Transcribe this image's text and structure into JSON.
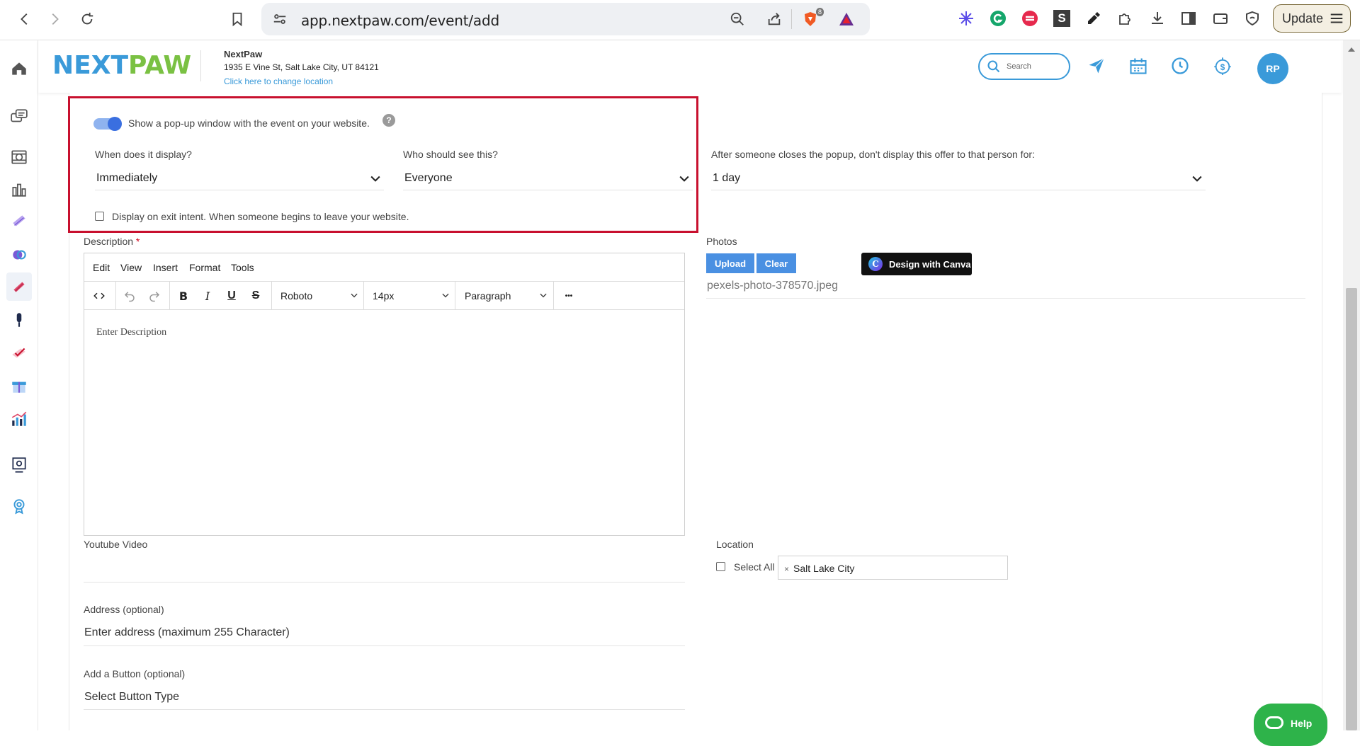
{
  "browser": {
    "url": "app.nextpaw.com/event/add",
    "update_label": "Update",
    "brave_badge": "8",
    "ext_s_label": "S"
  },
  "header": {
    "logo_next": "NEXT",
    "logo_paw": "PAW",
    "location_name": "NextPaw",
    "location_address": "1935 E Vine St, Salt Lake City, UT 84121",
    "change_location": "Click here to change location",
    "search_placeholder": "Search",
    "avatar_initials": "RP"
  },
  "popup": {
    "toggle_label": "Show a pop-up window with the event on your website.",
    "help_glyph": "?",
    "toggle_on": true,
    "when_label": "When does it display?",
    "when_value": "Immediately",
    "who_label": "Who should see this?",
    "who_value": "Everyone",
    "exit_intent_label": "Display on exit intent. When someone begins to leave your website.",
    "exit_intent_checked": false,
    "after_close_label": "After someone closes the popup, don't display this offer to that person for:",
    "after_close_value": "1 day"
  },
  "description": {
    "label": "Description",
    "required_mark": "*",
    "menu": [
      "Edit",
      "View",
      "Insert",
      "Format",
      "Tools"
    ],
    "font": "Roboto",
    "font_size": "14px",
    "block": "Paragraph",
    "more_glyph": "•••",
    "placeholder": "Enter Description"
  },
  "photos": {
    "label": "Photos",
    "upload_label": "Upload",
    "clear_label": "Clear",
    "canva_label": "Design with Canva",
    "canva_glyph": "C",
    "file_name": "pexels-photo-378570.jpeg"
  },
  "youtube": {
    "label": "Youtube Video"
  },
  "address": {
    "label": "Address (optional)",
    "placeholder": "Enter address (maximum 255 Character)"
  },
  "button_field": {
    "label": "Add a Button (optional)",
    "value": "Select Button Type"
  },
  "location": {
    "label": "Location",
    "select_all_label": "Select All",
    "tag": "Salt Lake City",
    "tag_remove": "×"
  },
  "help": {
    "label": "Help"
  },
  "colors": {
    "brand_blue": "#3a9ad9",
    "brand_green": "#7ac143",
    "highlight_red": "#c8102e",
    "help_green": "#2eb34a"
  }
}
